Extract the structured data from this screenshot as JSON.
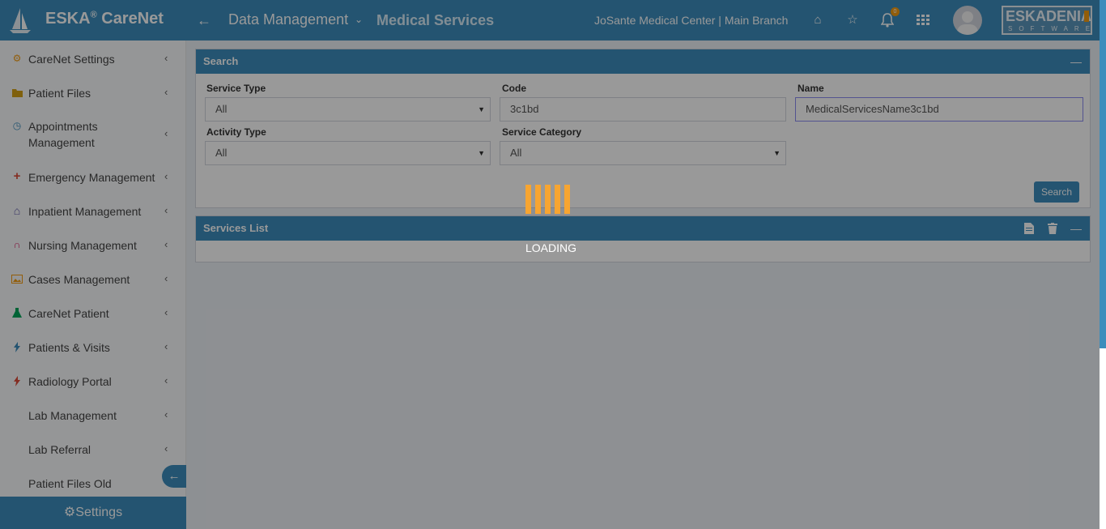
{
  "header": {
    "brand": "ESKA",
    "brand_reg": "®",
    "brand_suffix": " CareNet",
    "breadcrumb_section": "Data Management",
    "page_title": "Medical Services",
    "organization": "JoSante Medical Center | Main Branch",
    "notification_count": "0",
    "vendor_logo_text": "ESKADENIA",
    "vendor_logo_subtext": "SOFTWARE"
  },
  "sidebar": {
    "items": [
      {
        "label": "CareNet Settings",
        "icon": "gear-icon",
        "icon_color": "#f39c12"
      },
      {
        "label": "Patient Files",
        "icon": "folder-icon",
        "icon_color": "#d4a017"
      },
      {
        "label": "Appointments Management",
        "label_line1": "Appointments",
        "label_line2": "Management",
        "icon": "clock-icon",
        "icon_color": "#3c8dbc"
      },
      {
        "label": "Emergency Management",
        "icon": "plus-icon",
        "icon_color": "#dd4b39"
      },
      {
        "label": "Inpatient Management",
        "icon": "home-icon",
        "icon_color": "#605ca8"
      },
      {
        "label": "Nursing Management",
        "icon": "stethoscope-icon",
        "icon_color": "#d81b60"
      },
      {
        "label": "Cases Management",
        "icon": "image-icon",
        "icon_color": "#f39c12"
      },
      {
        "label": "CareNet Patient",
        "icon": "flask-icon",
        "icon_color": "#00a65a"
      },
      {
        "label": "Patients & Visits",
        "icon": "bolt-icon",
        "icon_color": "#3c8dbc"
      },
      {
        "label": "Radiology Portal",
        "icon": "bolt-icon",
        "icon_color": "#dd4b39"
      },
      {
        "label": "Lab Management",
        "icon": "",
        "icon_color": ""
      },
      {
        "label": "Lab Referral",
        "icon": "",
        "icon_color": ""
      },
      {
        "label": "Patient Files Old",
        "icon": "",
        "icon_color": ""
      }
    ],
    "settings_label": "Settings"
  },
  "search_panel": {
    "title": "Search",
    "fields": {
      "service_type": {
        "label": "Service Type",
        "value": "All"
      },
      "code": {
        "label": "Code",
        "value": "3c1bd"
      },
      "name": {
        "label": "Name",
        "value": "MedicalServicesName3c1bd"
      },
      "activity_type": {
        "label": "Activity Type",
        "value": "All"
      },
      "service_category": {
        "label": "Service Category",
        "value": "All"
      }
    },
    "search_button": "Search"
  },
  "services_panel": {
    "title": "Services List"
  },
  "loading": {
    "text": "LOADING"
  },
  "colors": {
    "primary": "#3c8dbc",
    "loader": "#f7a531",
    "overlay": "rgba(0,0,0,0.40)"
  }
}
